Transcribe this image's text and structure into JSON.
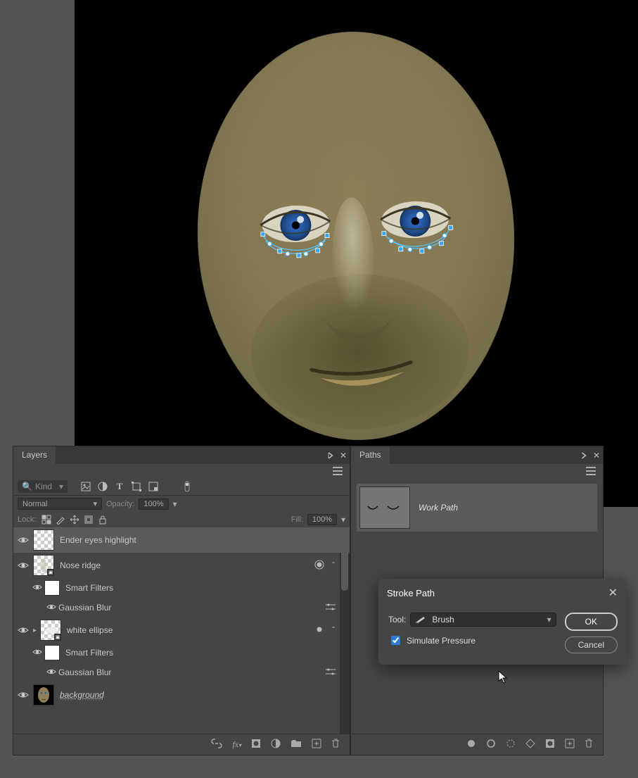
{
  "layers_panel": {
    "title": "Layers",
    "filter_kind_label": "Kind",
    "blend_mode": "Normal",
    "opacity_label": "Opacity:",
    "opacity_value": "100%",
    "lock_label": "Lock:",
    "fill_label": "Fill:",
    "fill_value": "100%",
    "layers": [
      {
        "name": "Ender eyes highlight",
        "selected": true,
        "thumb": "transparent"
      },
      {
        "name": "Nose ridge",
        "thumb": "transparent_smart",
        "smart_filters": true,
        "filters": [
          "Gaussian Blur"
        ],
        "has_mask": true
      },
      {
        "name": "white ellipse",
        "thumb": "transparent_smart",
        "smart_filters": true,
        "filters": [
          "Gaussian Blur"
        ],
        "has_mask": true,
        "link_indicator": true
      },
      {
        "name": "background",
        "thumb": "face",
        "underline": true
      }
    ],
    "smart_filters_label": "Smart Filters",
    "gaussian_blur_label": "Gaussian Blur"
  },
  "paths_panel": {
    "title": "Paths",
    "item_label": "Work Path"
  },
  "dialog": {
    "title": "Stroke Path",
    "tool_label": "Tool:",
    "tool_value": "Brush",
    "simulate_label": "Simulate Pressure",
    "simulate_checked": true,
    "ok_label": "OK",
    "cancel_label": "Cancel"
  }
}
